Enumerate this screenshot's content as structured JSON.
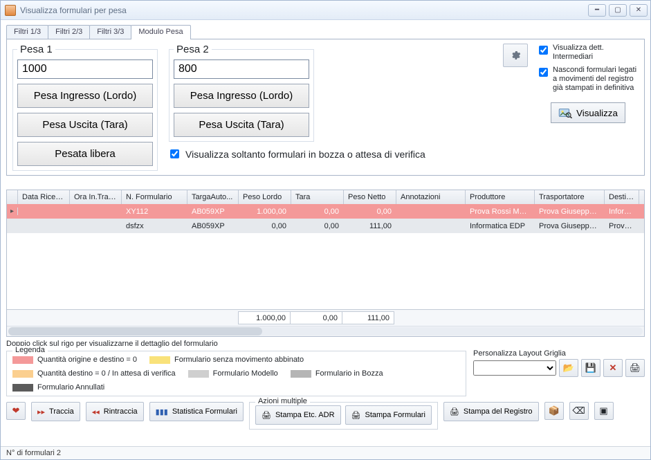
{
  "window": {
    "title": "Visualizza formulari per pesa"
  },
  "tabs": [
    "Filtri 1/3",
    "Filtri 2/3",
    "Filtri 3/3",
    "Modulo Pesa"
  ],
  "activeTab": 3,
  "pesa1": {
    "legend": "Pesa 1",
    "value": "1000",
    "btn_in": "Pesa Ingresso (Lordo)",
    "btn_out": "Pesa Uscita (Tara)",
    "btn_libera": "Pesata libera"
  },
  "pesa2": {
    "legend": "Pesa 2",
    "value": "800",
    "btn_in": "Pesa Ingresso (Lordo)",
    "btn_out": "Pesa Uscita (Tara)"
  },
  "bozza_checkbox": "Visualizza soltanto formulari in bozza o attesa di verifica",
  "right": {
    "visDettInt": "Visualizza dett. Intermediari",
    "nascondi": "Nascondi formulari legati a movimenti del registro già stampati in definitiva",
    "visualizza": "Visualizza"
  },
  "grid": {
    "columns": [
      "Data Ricezi...",
      "Ora In.Trasp.",
      "N. Formulario",
      "TargaAuto...",
      "Peso Lordo",
      "Tara",
      "Peso Netto",
      "Annotazioni",
      "Produttore",
      "Trasportatore",
      "Destinat"
    ],
    "rows": [
      {
        "sel": true,
        "data": "",
        "ora": "",
        "nform": "XY112",
        "targa": "AB059XP",
        "plordo": "1.000,00",
        "tara": "0,00",
        "pnetto": "0,00",
        "annot": "",
        "prod": "Prova Rossi Mario",
        "trasp": "Prova Giuseppe ...",
        "dest": "Informat"
      },
      {
        "sel": false,
        "data": "",
        "ora": "",
        "nform": "dsfzx",
        "targa": "AB059XP",
        "plordo": "0,00",
        "tara": "0,00",
        "pnetto": "111,00",
        "annot": "",
        "prod": "Informatica EDP",
        "trasp": "Prova Giuseppe ...",
        "dest": "Prova Gi"
      }
    ],
    "footer": {
      "plordo": "1.000,00",
      "tara": "0,00",
      "pnetto": "111,00"
    }
  },
  "hint": "Doppio click sul rigo per visualizzarne il dettaglio del formulario",
  "legend": {
    "title": "Legenda",
    "items": [
      {
        "color": "#f49999",
        "text": "Quantità origine e destino = 0"
      },
      {
        "color": "#f9e27a",
        "text": "Formulario senza movimento abbinato"
      },
      {
        "color": "#fbcf8f",
        "text": "Quantità destino = 0 / In attesa di verifica"
      },
      {
        "color": "#cfcfcf",
        "text": "Formulario Modello"
      },
      {
        "color": "#b5b5b5",
        "text": "Formulario in Bozza"
      },
      {
        "color": "#5b5b5b",
        "text": "Formulario Annullati"
      }
    ]
  },
  "layout": {
    "label": "Personalizza Layout Griglia"
  },
  "buttons": {
    "traccia": "Traccia",
    "rintraccia": "Rintraccia",
    "stat": "Statistica Formulari",
    "azioni_title": "Azioni multiple",
    "stampa_adr": "Stampa Etc. ADR",
    "stampa_form": "Stampa Formulari",
    "stampa_reg": "Stampa del Registro"
  },
  "status": "N° di formulari 2"
}
